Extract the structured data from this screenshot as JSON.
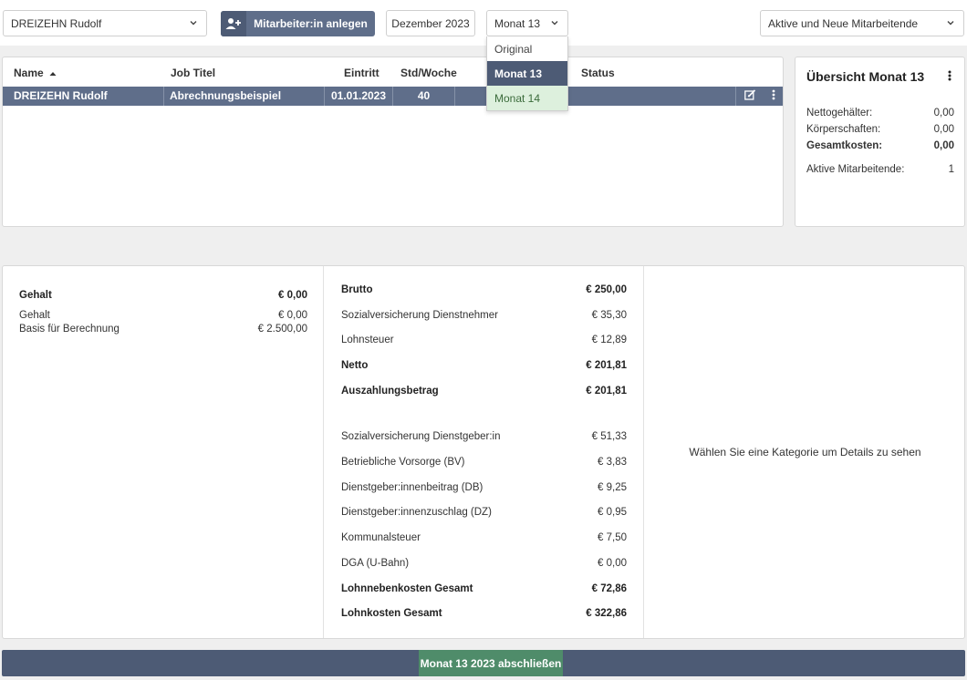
{
  "toolbar": {
    "employee_select": "DREIZEHN Rudolf",
    "add_button_label": "Mitarbeiter:in anlegen",
    "date": "Dezember 2023",
    "month_select": "Monat 13",
    "filter_select": "Aktive und Neue Mitarbeitende"
  },
  "month_dropdown": {
    "options": [
      "Original",
      "Monat 13",
      "Monat 14"
    ],
    "selected": "Monat 13"
  },
  "table": {
    "headers": {
      "name": "Name",
      "job": "Job Titel",
      "entry": "Eintritt",
      "hours": "Std/Woche",
      "status": "Status"
    },
    "rows": [
      {
        "name": "DREIZEHN Rudolf",
        "job": "Abrechnungsbeispiel",
        "entry": "01.01.2023",
        "hours": "40",
        "status": ""
      }
    ]
  },
  "overview": {
    "title": "Übersicht Monat 13",
    "rows": [
      {
        "label": "Nettogehälter:",
        "value": "0,00"
      },
      {
        "label": "Körperschaften:",
        "value": "0,00"
      },
      {
        "label": "Gesamtkosten:",
        "value": "0,00"
      },
      {
        "label": "Aktive Mitarbeitende:",
        "value": "1"
      }
    ]
  },
  "salary": {
    "title": "Gehalt",
    "title_value": "€ 0,00",
    "items": [
      {
        "label": "Gehalt",
        "value": "€ 0,00"
      },
      {
        "label": "Basis für Berechnung",
        "value": "€ 2.500,00"
      }
    ]
  },
  "breakdown": [
    {
      "label": "Brutto",
      "value": "€ 250,00"
    },
    {
      "label": "Sozialversicherung Dienstnehmer",
      "value": "€ 35,30"
    },
    {
      "label": "Lohnsteuer",
      "value": "€ 12,89"
    },
    {
      "label": "Netto",
      "value": "€ 201,81"
    },
    {
      "label": "Auszahlungsbetrag",
      "value": "€ 201,81"
    },
    {
      "label": "Sozialversicherung Dienstgeber:in",
      "value": "€ 51,33"
    },
    {
      "label": "Betriebliche Vorsorge (BV)",
      "value": "€ 3,83"
    },
    {
      "label": "Dienstgeber:innenbeitrag (DB)",
      "value": "€ 9,25"
    },
    {
      "label": "Dienstgeber:innenzuschlag (DZ)",
      "value": "€ 0,95"
    },
    {
      "label": "Kommunalsteuer",
      "value": "€ 7,50"
    },
    {
      "label": "DGA (U-Bahn)",
      "value": "€ 0,00"
    },
    {
      "label": "Lohnnebenkosten Gesamt",
      "value": "€ 72,86"
    },
    {
      "label": "Lohnkosten Gesamt",
      "value": "€ 322,86"
    }
  ],
  "details_hint": "Wählen Sie eine Kategorie um Details zu sehen",
  "finish_button": "Monat 13 2023 abschließen",
  "colors": {
    "primary": "#5f6e8a",
    "primary_dark": "#4d5b75",
    "success": "#4f8c6a",
    "hover_option": "#ddf0dd"
  }
}
